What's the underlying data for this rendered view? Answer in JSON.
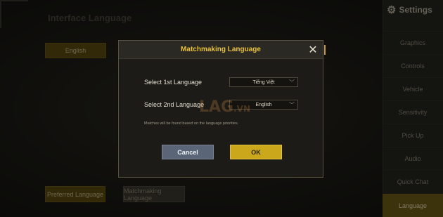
{
  "background": {
    "title": "Interface Language",
    "language_button": "English",
    "preferred_tab": "Preferred Language",
    "matchmaking_tab": "Matchmaking Language"
  },
  "sidebar": {
    "title": "Settings",
    "items": [
      {
        "label": "Graphics"
      },
      {
        "label": "Controls"
      },
      {
        "label": "Vehicle"
      },
      {
        "label": "Sensitivity"
      },
      {
        "label": "Pick Up"
      },
      {
        "label": "Audio"
      },
      {
        "label": "Quick Chat"
      },
      {
        "label": "Language",
        "active": true
      }
    ]
  },
  "modal": {
    "title": "Matchmaking Language",
    "first_label": "Select 1st Language",
    "first_value": "Tiếng Việt",
    "second_label": "Select 2nd Language",
    "second_value": "English",
    "note": "Matches will be found based on the language priorities.",
    "cancel_label": "Cancel",
    "ok_label": "OK"
  },
  "watermark": {
    "text": "LAG",
    "suffix": ".VN"
  },
  "colors": {
    "accent": "#caa71b",
    "title": "#e8c23a",
    "cancel": "#5a6677"
  },
  "icons": {
    "close": "close-icon",
    "settings": "gear-icon",
    "dropdown": "chevron-down-icon"
  }
}
